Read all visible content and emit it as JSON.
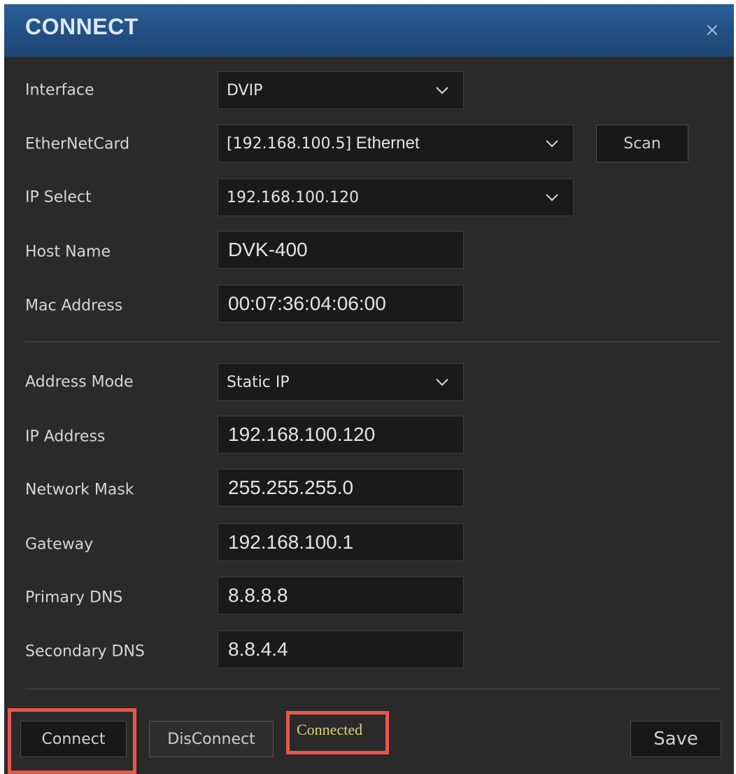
{
  "dialog": {
    "title": "CONNECT",
    "close_glyph": "×"
  },
  "fields": {
    "interface": {
      "label": "Interface",
      "value": "DVIP"
    },
    "ethernet_card": {
      "label": "EtherNetCard",
      "value_ip": "[192.168.100.5]",
      "value_name": " Ethernet"
    },
    "ip_select": {
      "label": "IP Select",
      "value": "192.168.100.120"
    },
    "host_name": {
      "label": "Host Name",
      "value": "DVK-400"
    },
    "mac_address": {
      "label": "Mac Address",
      "value": "00:07:36:04:06:00"
    },
    "address_mode": {
      "label": "Address Mode",
      "value": "Static IP"
    },
    "ip_address": {
      "label": "IP Address",
      "value": "192.168.100.120"
    },
    "network_mask": {
      "label": "Network Mask",
      "value": "255.255.255.0"
    },
    "gateway": {
      "label": "Gateway",
      "value": "192.168.100.1"
    },
    "primary_dns": {
      "label": "Primary DNS",
      "value": "8.8.8.8"
    },
    "secondary_dns": {
      "label": "Secondary DNS",
      "value": "8.8.4.4"
    }
  },
  "buttons": {
    "scan": "Scan",
    "connect": "Connect",
    "disconnect": "DisConnect",
    "save": "Save"
  },
  "status": {
    "text": "Connected",
    "color": "#d6d67a"
  },
  "colors": {
    "title_bar": "#234f82",
    "background": "#2a2a2a",
    "highlight": "#e8564a"
  }
}
